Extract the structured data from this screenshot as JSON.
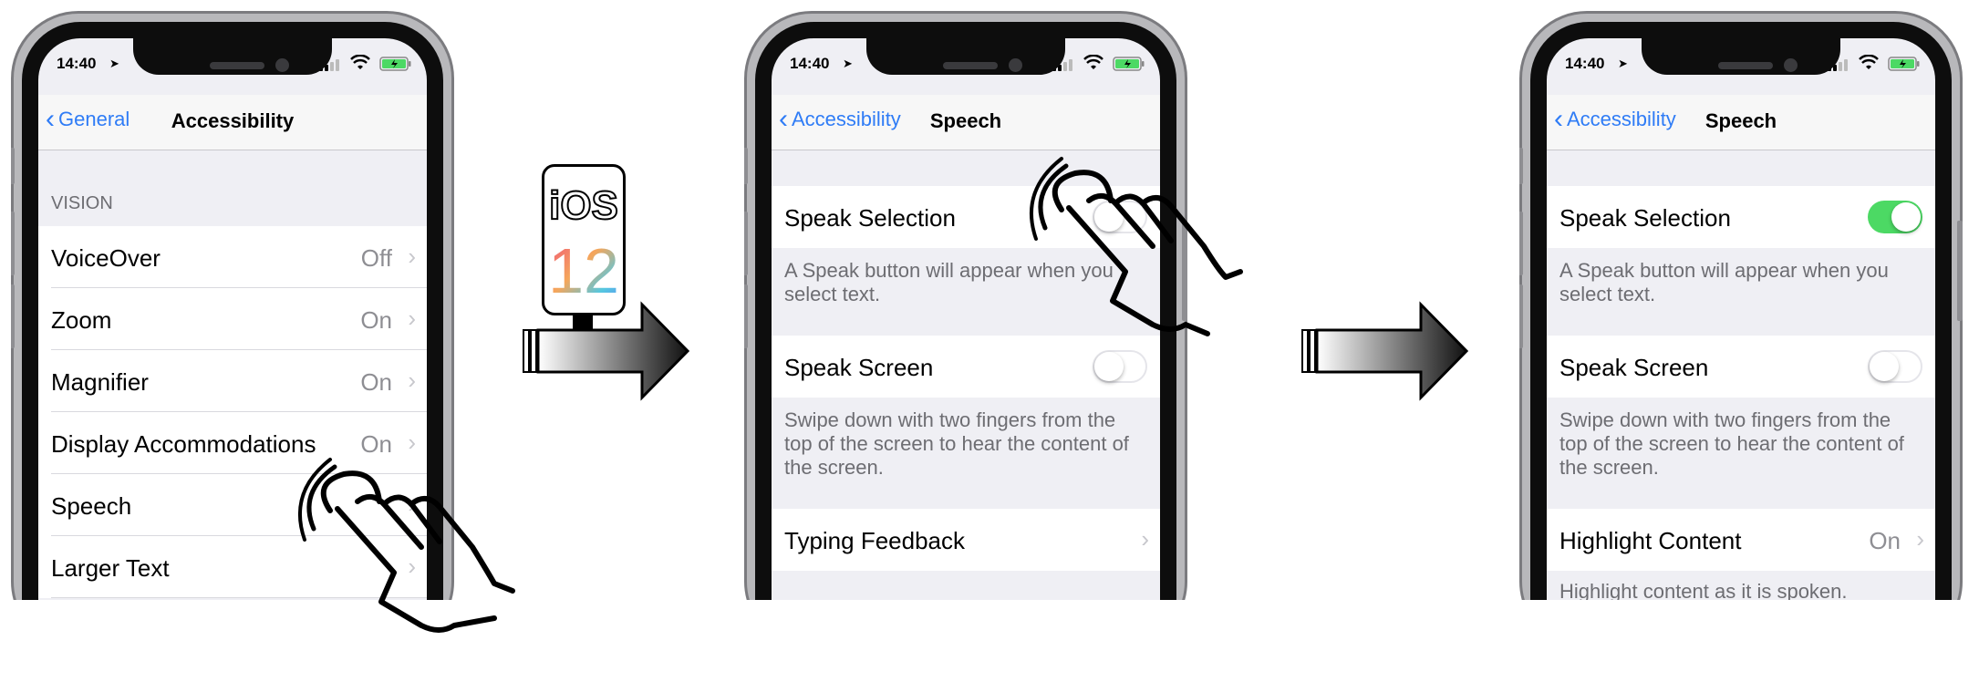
{
  "colors": {
    "accent": "#2f7cf6",
    "toggle_on": "#4cd964",
    "toggle_off_border": "#e5e5ea",
    "secondary_text": "#8e8e93"
  },
  "badge": {
    "os": "iOS",
    "version": "12"
  },
  "screens": [
    {
      "status": {
        "time": "14:40"
      },
      "nav": {
        "back": "General",
        "title": "Accessibility"
      },
      "section": "VISION",
      "rows": [
        {
          "label": "VoiceOver",
          "value": "Off"
        },
        {
          "label": "Zoom",
          "value": "On"
        },
        {
          "label": "Magnifier",
          "value": "On"
        },
        {
          "label": "Display Accommodations",
          "value": "On"
        },
        {
          "label": "Speech",
          "value": ""
        },
        {
          "label": "Larger Text",
          "value": ""
        }
      ]
    },
    {
      "status": {
        "time": "14:40"
      },
      "nav": {
        "back": "Accessibility",
        "title": "Speech"
      },
      "speak_selection": {
        "label": "Speak Selection",
        "on": false,
        "footer": "A Speak button will appear when you select text."
      },
      "speak_screen": {
        "label": "Speak Screen",
        "on": false,
        "footer": "Swipe down with two fingers from the top of the screen to hear the content of the screen."
      },
      "typing_feedback": {
        "label": "Typing Feedback"
      }
    },
    {
      "status": {
        "time": "14:40"
      },
      "nav": {
        "back": "Accessibility",
        "title": "Speech"
      },
      "speak_selection": {
        "label": "Speak Selection",
        "on": true,
        "footer": "A Speak button will appear when you select text."
      },
      "speak_screen": {
        "label": "Speak Screen",
        "on": false,
        "footer": "Swipe down with two fingers from the top of the screen to hear the content of the screen."
      },
      "highlight_content": {
        "label": "Highlight Content",
        "value": "On",
        "footer": "Highlight content as it is spoken."
      }
    }
  ]
}
